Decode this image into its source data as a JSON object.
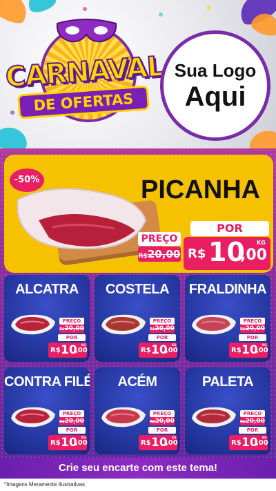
{
  "header": {
    "carnaval_title": "CARNAVAL",
    "ofertas_title": "DE OFERTAS",
    "logo_line1": "Sua Logo",
    "logo_line2": "Aqui"
  },
  "featured": {
    "discount": "-50%",
    "name": "PICANHA",
    "preco_label": "PREÇO",
    "old_currency": "R$",
    "old_amount": "20,00",
    "por_label": "POR",
    "currency": "R$",
    "price_int": "10",
    "price_dec": ",00",
    "unit": "KG"
  },
  "products": [
    {
      "name": "ALCATRA",
      "preco_label": "PREÇO",
      "old_currency": "R$",
      "old_amount": "20,00",
      "por_label": "POR",
      "currency": "R$",
      "price_int": "10",
      "price_dec": ",00",
      "unit": "KG"
    },
    {
      "name": "COSTELA",
      "preco_label": "PREÇO",
      "old_currency": "R$",
      "old_amount": "20,00",
      "por_label": "POR",
      "currency": "R$",
      "price_int": "10",
      "price_dec": ",00",
      "unit": "KG"
    },
    {
      "name": "FRALDINHA",
      "preco_label": "PREÇO",
      "old_currency": "R$",
      "old_amount": "20,00",
      "por_label": "POR",
      "currency": "R$",
      "price_int": "10",
      "price_dec": ",00",
      "unit": "KG"
    },
    {
      "name": "CONTRA FILÉ",
      "preco_label": "PREÇO",
      "old_currency": "R$",
      "old_amount": "20,00",
      "por_label": "POR",
      "currency": "R$",
      "price_int": "10",
      "price_dec": ",00",
      "unit": "KG"
    },
    {
      "name": "ACÉM",
      "preco_label": "PREÇO",
      "old_currency": "R$",
      "old_amount": "20,00",
      "por_label": "POR",
      "currency": "R$",
      "price_int": "10",
      "price_dec": ",00",
      "unit": "KG"
    },
    {
      "name": "PALETA",
      "preco_label": "PREÇO",
      "old_currency": "R$",
      "old_amount": "20,00",
      "por_label": "POR",
      "currency": "R$",
      "price_int": "10",
      "price_dec": ",00",
      "unit": "KG"
    }
  ],
  "footer": {
    "cta": "Crie seu encarte com este tema!",
    "disclaimer": "*Imagens Meramente Ilustrativas"
  },
  "colors": {
    "accent_pink": "#e91e63",
    "featured_yellow": "#f6c200",
    "card_blue": "#22339a",
    "purple": "#7a2ba8"
  }
}
